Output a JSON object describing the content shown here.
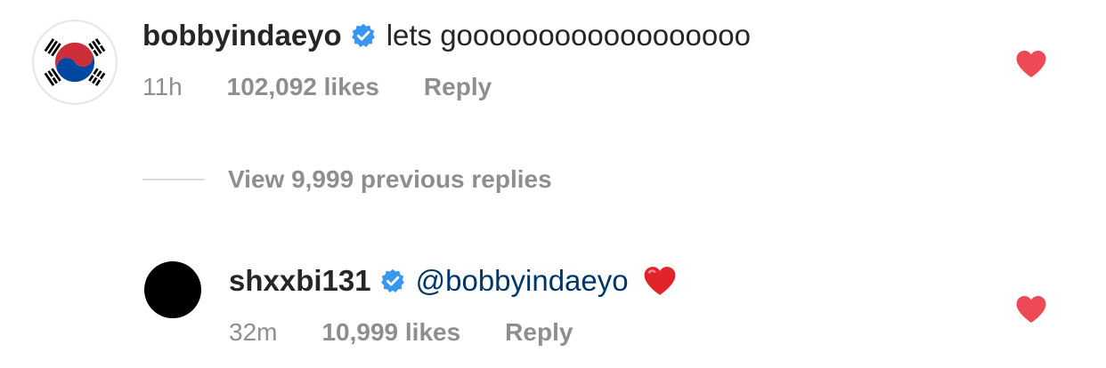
{
  "comment": {
    "username": "bobbyindaeyo",
    "text": "lets goooooooooooooooooo",
    "time": "11h",
    "likes": "102,092 likes",
    "reply_label": "Reply",
    "avatar": "south-korea-flag-icon",
    "liked": true
  },
  "view_replies": {
    "label": "View 9,999 previous replies"
  },
  "reply": {
    "username": "shxxbi131",
    "mention": "@bobbyindaeyo",
    "emoji": "red-heart-emoji",
    "time": "32m",
    "likes": "10,999 likes",
    "reply_label": "Reply",
    "liked": true
  },
  "colors": {
    "verified": "#3897f0",
    "like": "#ed4956",
    "mention": "#00376b",
    "secondary": "#8e8e8e"
  }
}
